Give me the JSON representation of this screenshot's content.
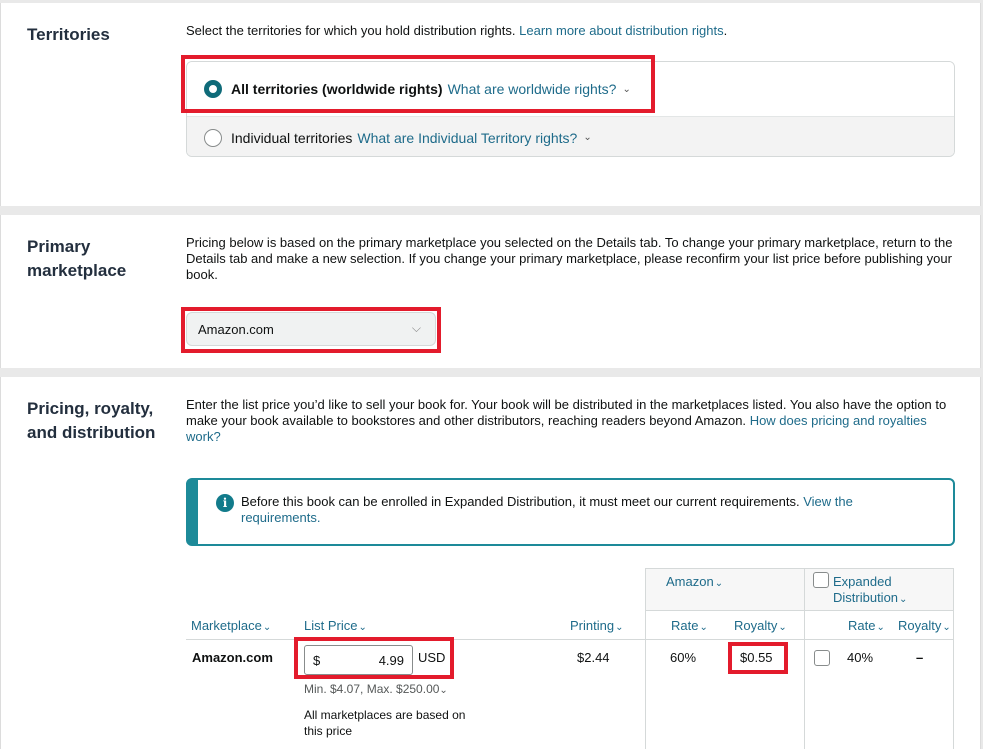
{
  "territories": {
    "title": "Territories",
    "description": "Select the territories for which you hold distribution rights.",
    "learn_more_link": "Learn more about distribution rights",
    "learn_more_suffix": ".",
    "options": [
      {
        "label": "All territories (worldwide rights)",
        "info_link": "What are worldwide rights?",
        "selected": true
      },
      {
        "label": "Individual territories",
        "info_link": "What are Individual Territory rights?",
        "selected": false
      }
    ]
  },
  "primary_marketplace": {
    "title_line1": "Primary",
    "title_line2": "marketplace",
    "description": "Pricing below is based on the primary marketplace you selected on the Details tab. To change your primary marketplace, return to the Details tab and make a new selection. If you change your primary marketplace, please reconfirm your list price before publishing your book.",
    "selected_value": "Amazon.com"
  },
  "pricing": {
    "title_line1": "Pricing, royalty,",
    "title_line2": "and distribution",
    "description": "Enter the list price you’d like to sell your book for. Your book will be distributed in the marketplaces listed. You also have the option to make your book available to bookstores and other distributors, reaching readers beyond Amazon.",
    "description_link": "How does pricing and royalties work?",
    "alert_text": "Before this book can be enrolled in Expanded Distribution, it must meet our current requirements.",
    "alert_link": "View the requirements.",
    "table": {
      "group_amazon": "Amazon",
      "group_expanded_line1": "Expanded",
      "group_expanded_line2": "Distribution",
      "col_marketplace": "Marketplace",
      "col_list_price": "List Price",
      "col_printing": "Printing",
      "col_rate": "Rate",
      "col_royalty": "Royalty",
      "col_exp_rate": "Rate",
      "col_exp_royalty": "Royalty",
      "row": {
        "marketplace": "Amazon.com",
        "currency_symbol": "$",
        "price": "4.99",
        "currency": "USD",
        "min_max": "Min. $4.07, Max. $250.00",
        "note_line1": "All marketplaces are based on",
        "note_line2": "this price",
        "printing": "$2.44",
        "rate": "60%",
        "royalty": "$0.55",
        "exp_rate": "40%",
        "exp_royalty": "–"
      }
    }
  }
}
